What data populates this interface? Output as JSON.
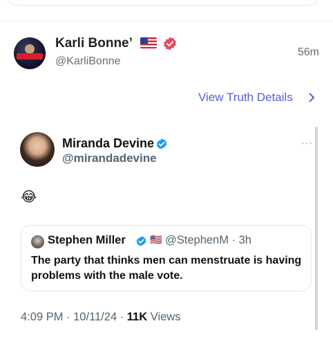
{
  "truth": {
    "display_name": "Karli Bonne’",
    "handle": "@KarliBonne",
    "time": "56m",
    "details_link": "View Truth Details",
    "avatar_text": "MidnightRider",
    "colors": {
      "accent": "#5560d8",
      "verified_badge": "#e8475c"
    }
  },
  "tweet": {
    "author_name": "Miranda Devine",
    "author_handle": "@mirandadevine",
    "body_emoji": "😂",
    "more_label": "···",
    "quote": {
      "author_name": "Stephen Miller",
      "author_handle_time": "@StephenM · 3h",
      "badge_emoji": "🇺🇸",
      "text": "The party that thinks men can menstruate is having problems with the male vote."
    },
    "timestamp": "4:09 PM · 10/11/24 · ",
    "views_count": "11K",
    "views_label": " Views",
    "colors": {
      "verified": "#1d9bf0"
    }
  }
}
